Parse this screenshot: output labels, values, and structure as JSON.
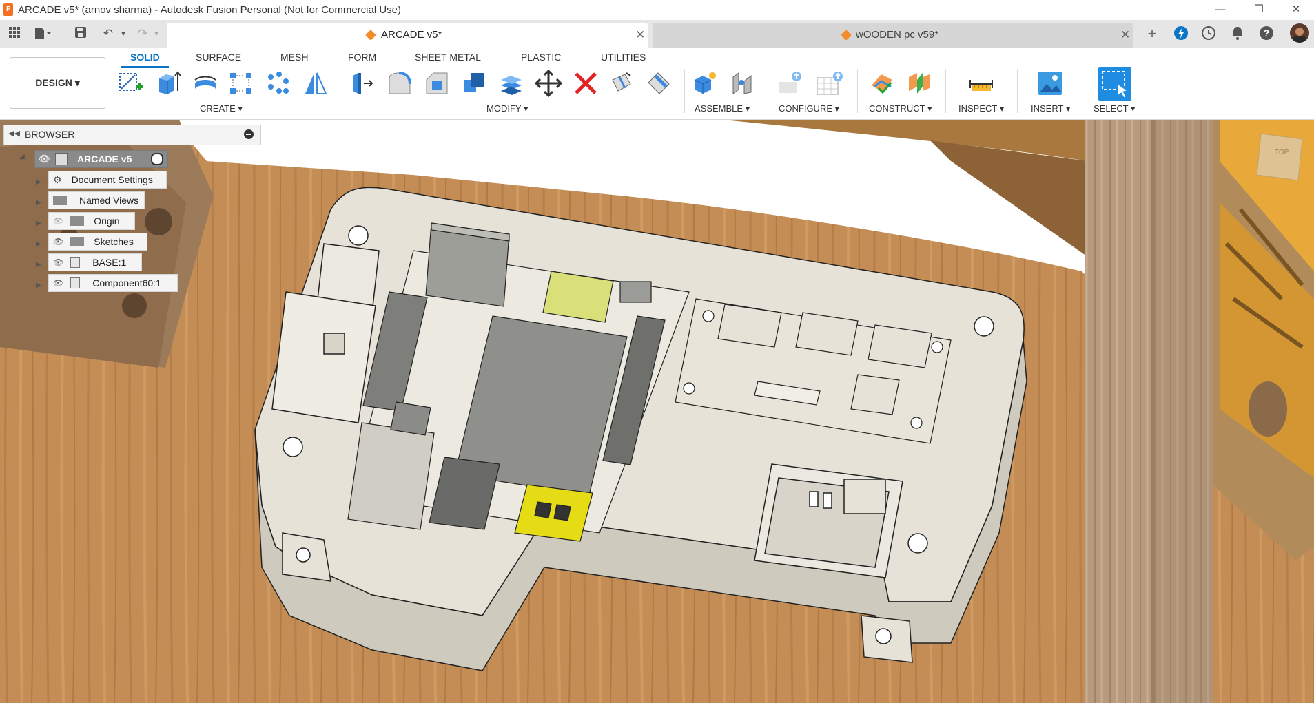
{
  "window": {
    "title": "ARCADE v5* (arnov sharma) - Autodesk Fusion Personal (Not for Commercial Use)",
    "logo_letter": "F"
  },
  "tabs": [
    {
      "label": "ARCADE v5*",
      "active": true
    },
    {
      "label": "wOODEN pc v59*",
      "active": false
    }
  ],
  "toolbar": {
    "workspace": "DESIGN",
    "workspace_tabs": [
      "SOLID",
      "SURFACE",
      "MESH",
      "FORM",
      "SHEET METAL",
      "PLASTIC",
      "UTILITIES"
    ],
    "active_tab": "SOLID",
    "groups": {
      "create": "CREATE",
      "modify": "MODIFY",
      "assemble": "ASSEMBLE",
      "configure": "CONFIGURE",
      "construct": "CONSTRUCT",
      "inspect": "INSPECT",
      "insert": "INSERT",
      "select": "SELECT"
    }
  },
  "browser": {
    "title": "BROWSER",
    "root": "ARCADE v5",
    "items": [
      {
        "label": "Document Settings",
        "icon": "gear-icon",
        "visible": null
      },
      {
        "label": "Named Views",
        "icon": "folder-icon",
        "visible": null
      },
      {
        "label": "Origin",
        "icon": "folder-icon",
        "visible": false
      },
      {
        "label": "Sketches",
        "icon": "folder-icon",
        "visible": true
      },
      {
        "label": "BASE:1",
        "icon": "component-icon",
        "visible": true
      },
      {
        "label": "Component60:1",
        "icon": "component-icon",
        "visible": true
      }
    ]
  },
  "colors": {
    "accent": "#0b74c4",
    "wood": "#c08a52",
    "part": "#e8e4dc",
    "hdmi": "#e6dc16",
    "sdcard": "#d9e07a",
    "title_logo": "#f37021"
  }
}
